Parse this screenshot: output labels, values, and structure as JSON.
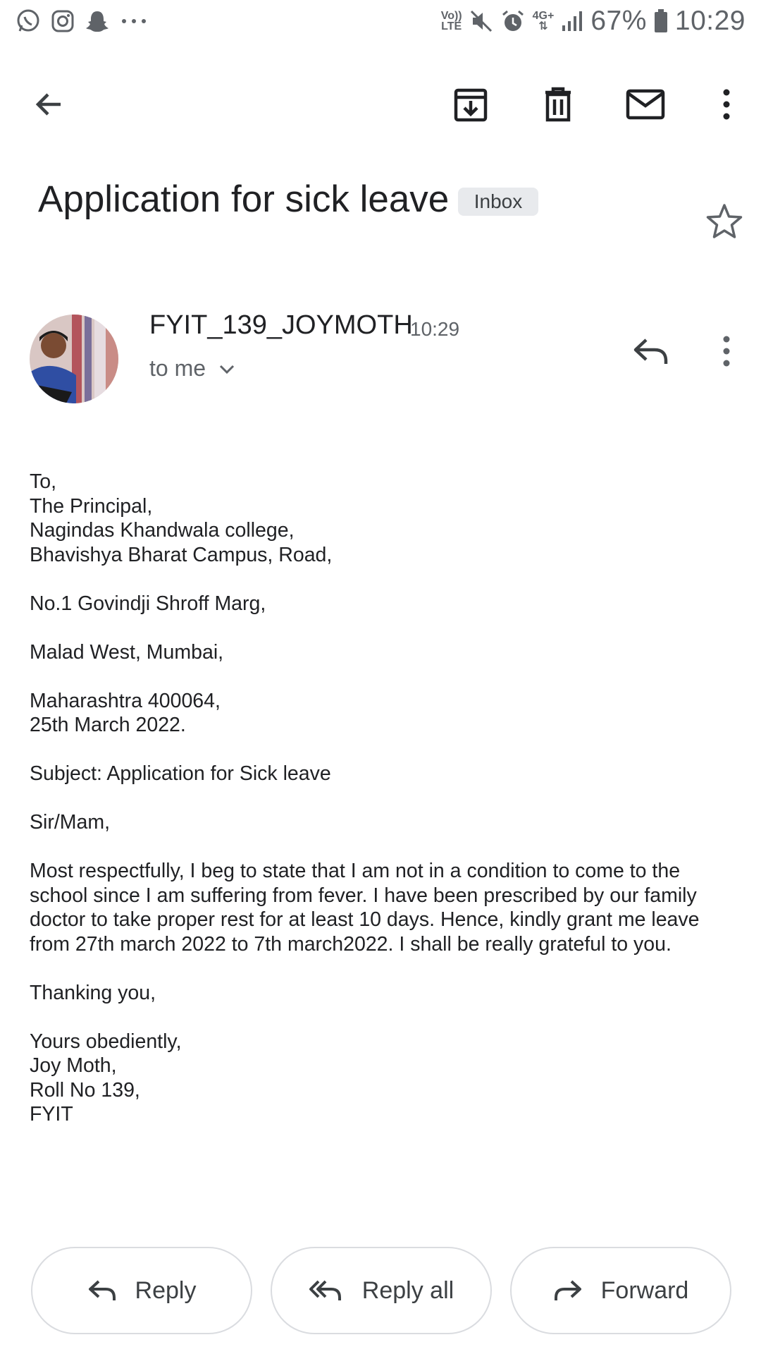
{
  "status_bar": {
    "left_icons": [
      "whatsapp-icon",
      "instagram-icon",
      "snapchat-icon",
      "more-notifications-icon"
    ],
    "volte_label_top": "Vo))",
    "volte_label_bottom": "LTE",
    "network_label": "4G+",
    "battery": "67%",
    "time": "10:29"
  },
  "toolbar": {
    "icons": [
      "back-arrow-icon",
      "archive-icon",
      "delete-icon",
      "mark-unread-icon",
      "more-vert-icon"
    ]
  },
  "email": {
    "subject": "Application for sick leave",
    "label": "Inbox",
    "sender": "FYIT_139_JOYMOTH",
    "time": "10:29",
    "recipient": "to me",
    "body": {
      "address": [
        "To,",
        "The Principal,",
        "Nagindas Khandwala college,",
        "Bhavishya Bharat Campus, Road,"
      ],
      "street": "No.1 Govindji Shroff Marg,",
      "area": "Malad West, Mumbai,",
      "state_line": "Maharashtra 400064,",
      "date": "25th March 2022.",
      "subject_line": "Subject: Application for Sick leave",
      "salutation": "Sir/Mam,",
      "paragraph": [
        "Most respectfully, I beg to state that I am not in a condition to come to the",
        "school since I am suffering from fever. I have been prescribed by our family",
        "doctor to take proper rest for at least 10 days. Hence, kindly grant me leave",
        "from 27th march 2022 to 7th march2022. I shall be really grateful to you."
      ],
      "thanks": "Thanking you,",
      "signature": [
        "Yours obediently,",
        "Joy Moth,",
        "Roll No 139,",
        "FYIT"
      ]
    }
  },
  "actions": {
    "reply": "Reply",
    "reply_all": "Reply all",
    "forward": "Forward"
  }
}
